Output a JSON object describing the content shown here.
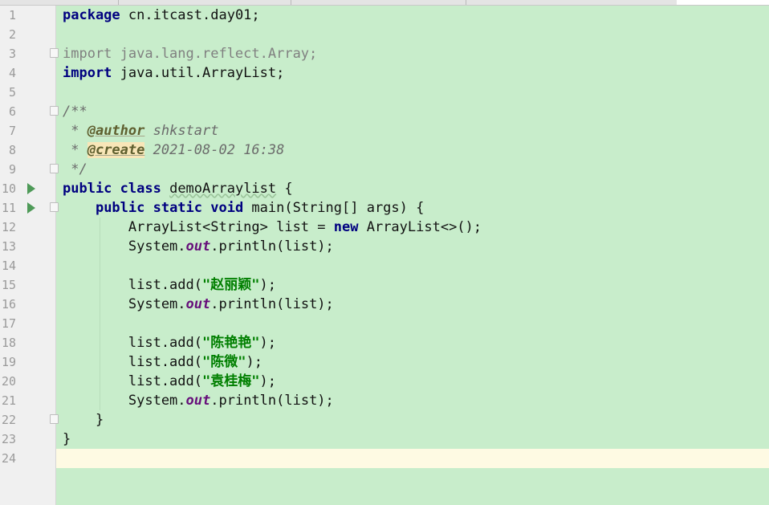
{
  "editor": {
    "lines": [
      {
        "n": "1",
        "t": "package cn.itcast.day01;"
      },
      {
        "n": "2",
        "t": ""
      },
      {
        "n": "3",
        "t": "import java.lang.reflect.Array;"
      },
      {
        "n": "4",
        "t": "import java.util.ArrayList;"
      },
      {
        "n": "5",
        "t": ""
      },
      {
        "n": "6",
        "t": "/**"
      },
      {
        "n": "7",
        "t": " * @author shkstart"
      },
      {
        "n": "8",
        "t": " * @create 2021-08-02 16:38"
      },
      {
        "n": "9",
        "t": " */"
      },
      {
        "n": "10",
        "t": "public class demoArraylist {"
      },
      {
        "n": "11",
        "t": "    public static void main(String[] args) {"
      },
      {
        "n": "12",
        "t": "        ArrayList<String> list = new ArrayList<>();"
      },
      {
        "n": "13",
        "t": "        System.out.println(list);"
      },
      {
        "n": "14",
        "t": ""
      },
      {
        "n": "15",
        "t": "        list.add(\"赵丽颖\");"
      },
      {
        "n": "16",
        "t": "        System.out.println(list);"
      },
      {
        "n": "17",
        "t": ""
      },
      {
        "n": "18",
        "t": "        list.add(\"陈艳艳\");"
      },
      {
        "n": "19",
        "t": "        list.add(\"陈微\");"
      },
      {
        "n": "20",
        "t": "        list.add(\"袁桂梅\");"
      },
      {
        "n": "21",
        "t": "        System.out.println(list);"
      },
      {
        "n": "22",
        "t": "    }"
      },
      {
        "n": "23",
        "t": "}"
      },
      {
        "n": "24",
        "t": ""
      }
    ],
    "current_line": "24"
  },
  "colors": {
    "background": "#c8edcb",
    "keyword": "#000080",
    "string": "#007f00",
    "static_field": "#660e7a",
    "comment": "#6b6b6b",
    "unused_import": "#808080",
    "current_line": "#fefae3",
    "run_icon": "#4e9a58"
  },
  "icons": {
    "run": "run-gutter-icon",
    "fold": "fold-marker-icon"
  }
}
